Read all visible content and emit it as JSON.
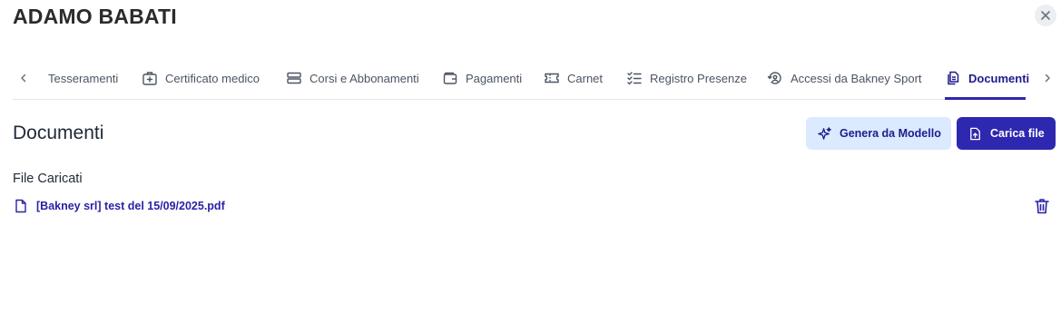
{
  "header": {
    "title": "ADAMO BABATI",
    "close_icon": "close-icon"
  },
  "tabs": [
    {
      "label": "Tesseramenti",
      "icon": "none",
      "active": false
    },
    {
      "label": "Certificato medico",
      "icon": "medical-case-icon",
      "active": false
    },
    {
      "label": "Corsi e Abbonamenti",
      "icon": "stack-icon",
      "active": false
    },
    {
      "label": "Pagamenti",
      "icon": "wallet-icon",
      "active": false
    },
    {
      "label": "Carnet",
      "icon": "ticket-icon",
      "active": false
    },
    {
      "label": "Registro Presenze",
      "icon": "checklist-icon",
      "active": false
    },
    {
      "label": "Accessi da Bakney Sport",
      "icon": "access-history-icon",
      "active": false
    },
    {
      "label": "Documenti",
      "icon": "documents-icon",
      "active": true
    }
  ],
  "section": {
    "title": "Documenti",
    "generate_button": "Genera da Modello",
    "upload_button": "Carica file",
    "files_heading": "File Caricati"
  },
  "files": [
    {
      "name": "[Bakney srl] test del 15/09/2025.pdf"
    }
  ],
  "colors": {
    "accent": "#2e27b0",
    "accent_text": "#1e1b8f",
    "light_button_bg": "#dbeafe",
    "tab_text": "#4b5563"
  }
}
